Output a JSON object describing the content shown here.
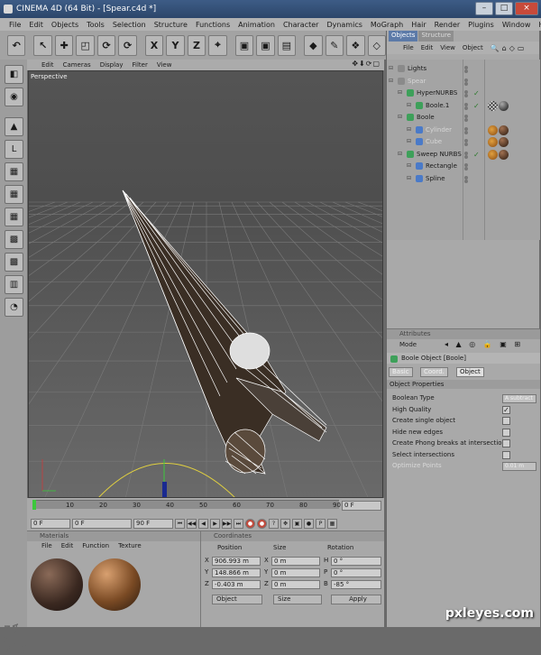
{
  "window": {
    "title": "CINEMA 4D (64 Bit) - [Spear.c4d *]",
    "controls": [
      "–",
      "□",
      "×"
    ]
  },
  "menubar": [
    "File",
    "Edit",
    "Objects",
    "Tools",
    "Selection",
    "Structure",
    "Functions",
    "Animation",
    "Character",
    "Dynamics",
    "MoGraph",
    "Hair",
    "Render",
    "Plugins",
    "Window",
    "Help"
  ],
  "toolbar": {
    "buttons": [
      {
        "name": "undo-icon",
        "glyph": "↶"
      },
      {
        "name": "live-selection-icon",
        "glyph": "↖"
      },
      {
        "name": "move-icon",
        "glyph": "✚"
      },
      {
        "name": "scale-icon",
        "glyph": "◰"
      },
      {
        "name": "rotate-icon",
        "glyph": "⟳"
      },
      {
        "name": "recent-tool-icon",
        "glyph": "⟳"
      },
      {
        "name": "x-axis-lock-icon",
        "glyph": "X"
      },
      {
        "name": "y-axis-lock-icon",
        "glyph": "Y"
      },
      {
        "name": "z-axis-lock-icon",
        "glyph": "Z"
      },
      {
        "name": "coordinate-system-icon",
        "glyph": "⌖"
      },
      {
        "name": "render-view-icon",
        "glyph": "▣"
      },
      {
        "name": "render-picture-viewer-icon",
        "glyph": "▣"
      },
      {
        "name": "render-settings-icon",
        "glyph": "▤"
      },
      {
        "name": "cube-primitive-icon",
        "glyph": "◆"
      },
      {
        "name": "spline-pen-icon",
        "glyph": "✎"
      },
      {
        "name": "nurbs-icon",
        "glyph": "❖"
      },
      {
        "name": "array-icon",
        "glyph": "◇"
      }
    ]
  },
  "lefttools": [
    {
      "name": "model-mode-icon",
      "glyph": "◧"
    },
    {
      "name": "object-mode-icon",
      "glyph": "◉"
    },
    {
      "name": "texture-mode-icon",
      "glyph": "▲"
    },
    {
      "name": "axis-mode-icon",
      "glyph": "L"
    },
    {
      "name": "points-mode-icon",
      "glyph": "▦"
    },
    {
      "name": "edges-mode-icon",
      "glyph": "▦"
    },
    {
      "name": "polygons-mode-icon",
      "glyph": "▦"
    },
    {
      "name": "tweak-mode-icon",
      "glyph": "▩"
    },
    {
      "name": "snap-icon",
      "glyph": "▩"
    },
    {
      "name": "workplane-icon",
      "glyph": "▥"
    },
    {
      "name": "paint-icon",
      "glyph": "◔"
    }
  ],
  "viewport": {
    "menu": [
      "Edit",
      "Cameras",
      "Display",
      "Filter",
      "View"
    ],
    "nav_icons": "✥⬇⟳▢",
    "label": "Perspective"
  },
  "timeline": {
    "ticks": [
      "0",
      "10",
      "20",
      "30",
      "40",
      "50",
      "60",
      "70",
      "80",
      "90"
    ],
    "current_frame": "0 F"
  },
  "transport": {
    "start_field": "0 F",
    "range_field": "0 F",
    "end_field": "90 F",
    "buttons": [
      "⏮",
      "◀◀",
      "◀",
      "▶",
      "▶▶",
      "⏭",
      "●",
      "●",
      "?",
      "✥",
      "▣",
      "●",
      "P",
      "▦"
    ]
  },
  "materials": {
    "header": "Materials",
    "menu": [
      "File",
      "Edit",
      "Function",
      "Texture"
    ]
  },
  "coordinates": {
    "header": "Coordinates",
    "columns": {
      "position": "Position",
      "size": "Size",
      "rotation": "Rotation"
    },
    "rows": [
      {
        "axis": "X",
        "pos": "906.993 m",
        "size_axis": "X",
        "size": "0 m",
        "rot_axis": "H",
        "rot": "0 °"
      },
      {
        "axis": "Y",
        "pos": "148.866 m",
        "size_axis": "Y",
        "size": "0 m",
        "rot_axis": "P",
        "rot": "0 °"
      },
      {
        "axis": "Z",
        "pos": "-0.403 m",
        "size_axis": "Z",
        "size": "0 m",
        "rot_axis": "B",
        "rot": "-85 °"
      }
    ],
    "mode_dropdown": "Object",
    "size_dropdown": "Size",
    "apply_label": "Apply"
  },
  "objects": {
    "tabs": [
      "Objects",
      "Structure"
    ],
    "menu": [
      "File",
      "Edit",
      "View",
      "Object"
    ],
    "items": [
      {
        "name": "Lights",
        "indent": 0,
        "dim": false,
        "icon_color": "#8a8a8a",
        "dot_color": "#777777",
        "check": "",
        "tags": []
      },
      {
        "name": "Spear",
        "indent": 0,
        "dim": true,
        "icon_color": "#8a8a8a",
        "dot_color": "#777777",
        "check": "",
        "tags": []
      },
      {
        "name": "HyperNURBS",
        "indent": 1,
        "dim": false,
        "icon_color": "#3ea05a",
        "dot_color": "#777777",
        "check": "✓",
        "tags": []
      },
      {
        "name": "Boole.1",
        "indent": 2,
        "dim": false,
        "icon_color": "#3ea05a",
        "dot_color": "#777777",
        "check": "✓",
        "tags": [
          "checker",
          "sphere-dark"
        ]
      },
      {
        "name": "Boole",
        "indent": 1,
        "dim": false,
        "icon_color": "#3ea05a",
        "dot_color": "#777777",
        "check": "",
        "tags": []
      },
      {
        "name": "Cylinder",
        "indent": 2,
        "dim": true,
        "icon_color": "#4a7ac8",
        "dot_color": "#777777",
        "check": "",
        "tags": [
          "phong",
          "sphere-brown"
        ]
      },
      {
        "name": "Cube",
        "indent": 2,
        "dim": true,
        "icon_color": "#4a7ac8",
        "dot_color": "#777777",
        "check": "",
        "tags": [
          "phong",
          "sphere-brown"
        ]
      },
      {
        "name": "Sweep NURBS",
        "indent": 1,
        "dim": false,
        "icon_color": "#3ea05a",
        "dot_color": "#777777",
        "check": "✓",
        "tags": [
          "phong",
          "sphere-brown"
        ]
      },
      {
        "name": "Rectangle",
        "indent": 2,
        "dim": false,
        "icon_color": "#4a7ac8",
        "dot_color": "#777777",
        "check": "",
        "tags": []
      },
      {
        "name": "Spline",
        "indent": 2,
        "dim": false,
        "icon_color": "#4a7ac8",
        "dot_color": "#777777",
        "check": "",
        "tags": []
      }
    ]
  },
  "attributes": {
    "header": "Attributes",
    "mode": "Mode",
    "object_title": "Boole Object [Boole]",
    "tabs": [
      "Basic",
      "Coord.",
      "Object"
    ],
    "section": "Object Properties",
    "props": [
      {
        "label": "Boolean Type",
        "kind": "dropdown",
        "value": "A subtract",
        "dim": false
      },
      {
        "label": "High Quality",
        "kind": "check",
        "value": "✓",
        "dim": false
      },
      {
        "label": "Create single object",
        "kind": "check",
        "value": "",
        "dim": false
      },
      {
        "label": "Hide new edges",
        "kind": "check",
        "value": "",
        "dim": false
      },
      {
        "label": "Create Phong breaks at intersections",
        "kind": "check",
        "value": "",
        "dim": false
      },
      {
        "label": "Select intersections",
        "kind": "check",
        "value": "",
        "dim": false
      },
      {
        "label": "Optimize Points",
        "kind": "dropdown",
        "value": "0.01 m",
        "dim": true
      }
    ]
  },
  "branding": {
    "maxon": "MAXON CINEMA 4D",
    "watermark": "pxleyes.com"
  },
  "colors": {
    "accent": "#5c7aa8",
    "wire": "#ffffff",
    "grid": "#7a7a7a"
  }
}
